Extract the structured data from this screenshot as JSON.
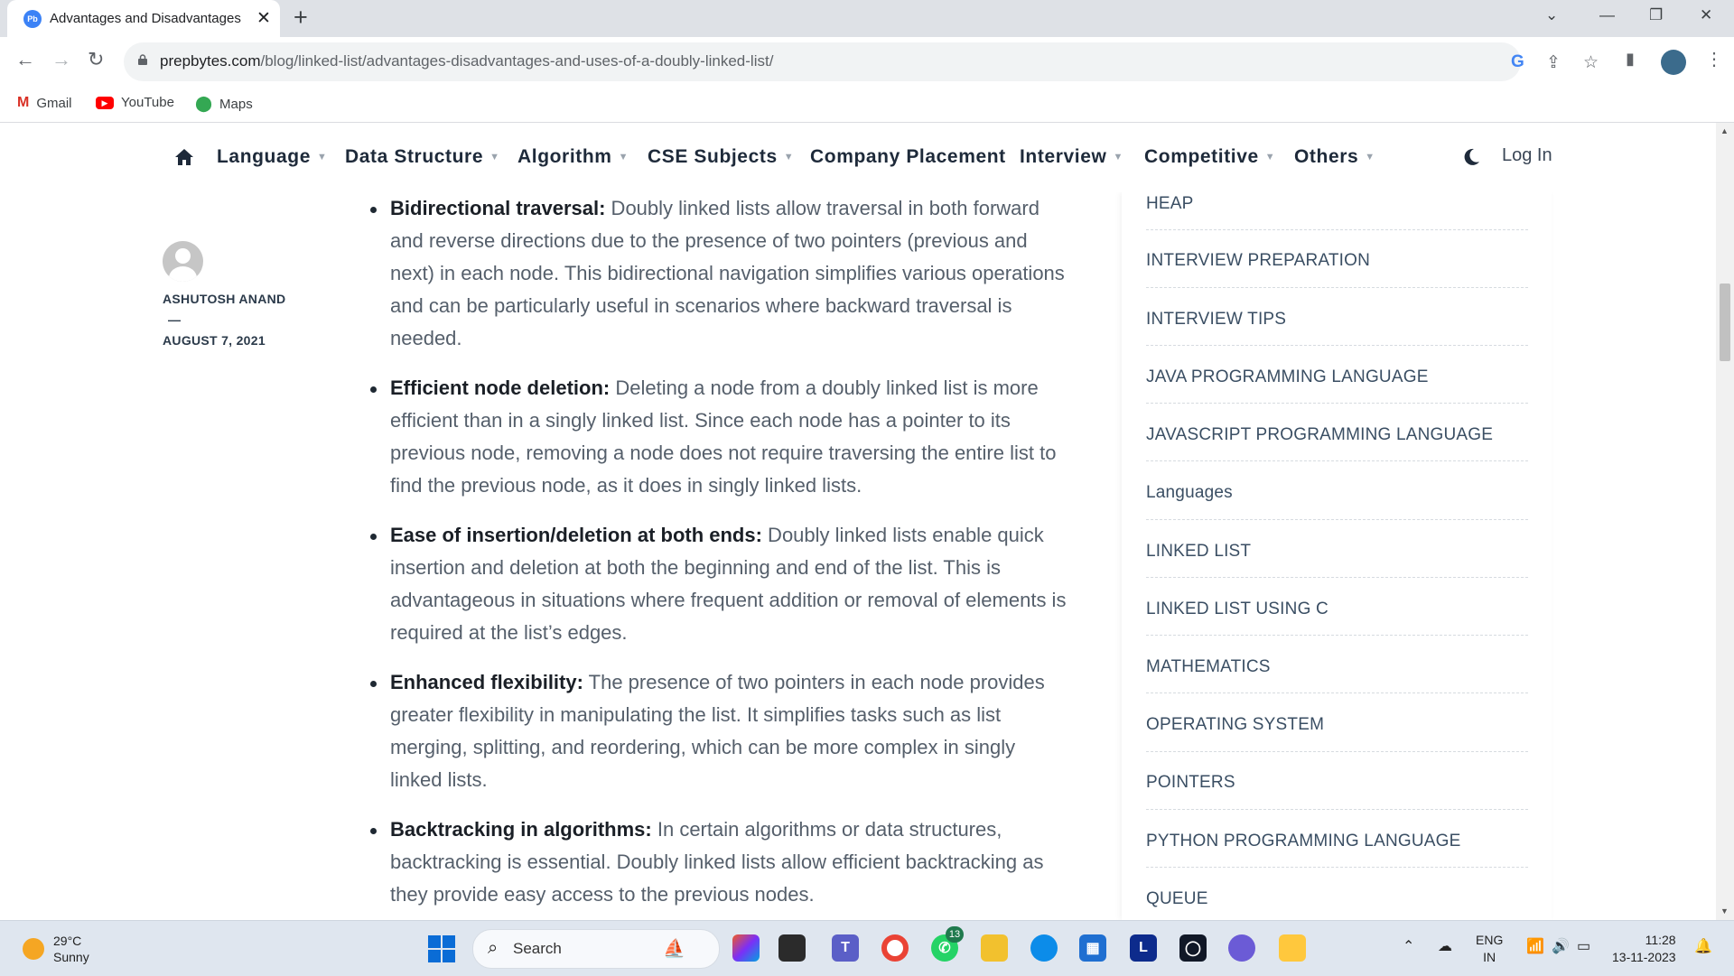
{
  "browser": {
    "tab_title": "Advantages and Disadvantages",
    "tab_favicon_text": "Pb",
    "url_host": "prepbytes.com",
    "url_path": "/blog/linked-list/advantages-disadvantages-and-uses-of-a-doubly-linked-list/",
    "bookmarks": [
      {
        "label": "Gmail",
        "icon": "gmail-icon"
      },
      {
        "label": "YouTube",
        "icon": "youtube-icon"
      },
      {
        "label": "Maps",
        "icon": "maps-icon"
      }
    ]
  },
  "site_nav": {
    "items": [
      {
        "label": "Language",
        "has_dropdown": true
      },
      {
        "label": "Data Structure",
        "has_dropdown": true
      },
      {
        "label": "Algorithm",
        "has_dropdown": true
      },
      {
        "label": "CSE Subjects",
        "has_dropdown": true
      },
      {
        "label": "Company Placement",
        "has_dropdown": false
      },
      {
        "label": "Interview",
        "has_dropdown": true
      },
      {
        "label": "Competitive",
        "has_dropdown": true
      },
      {
        "label": "Others",
        "has_dropdown": true
      }
    ],
    "login_label": "Log In"
  },
  "author": {
    "name": "ASHUTOSH ANAND",
    "separator": "—",
    "date": "AUGUST 7, 2021"
  },
  "article": {
    "bullets": [
      {
        "title": "Bidirectional traversal:",
        "text": " Doubly linked lists allow traversal in both forward and reverse directions due to the presence of two pointers (previous and next) in each node. This bidirectional navigation simplifies various operations and can be particularly useful in scenarios where backward traversal is needed."
      },
      {
        "title": "Efficient node deletion:",
        "text": " Deleting a node from a doubly linked list is more efficient than in a singly linked list. Since each node has a pointer to its previous node, removing a node does not require traversing the entire list to find the previous node, as it does in singly linked lists."
      },
      {
        "title": "Ease of insertion/deletion at both ends:",
        "text": " Doubly linked lists enable quick insertion and deletion at both the beginning and end of the list. This is advantageous in situations where frequent addition or removal of elements is required at the list’s edges."
      },
      {
        "title": "Enhanced flexibility:",
        "text": " The presence of two pointers in each node provides greater flexibility in manipulating the list. It simplifies tasks such as list merging, splitting, and reordering, which can be more complex in singly linked lists."
      },
      {
        "title": "Backtracking in algorithms:",
        "text": " In certain algorithms or data structures, backtracking is essential. Doubly linked lists allow efficient backtracking as they provide easy access to the previous nodes."
      }
    ]
  },
  "sidebar": {
    "categories": [
      "HEAP",
      "INTERVIEW PREPARATION",
      "INTERVIEW TIPS",
      "JAVA PROGRAMMING LANGUAGE",
      "JAVASCRIPT PROGRAMMING LANGUAGE",
      "Languages",
      "LINKED LIST",
      "LINKED LIST USING C",
      "MATHEMATICS",
      "OPERATING SYSTEM",
      "POINTERS",
      "PYTHON PROGRAMMING LANGUAGE",
      "QUEUE"
    ]
  },
  "taskbar": {
    "weather_temp": "29°C",
    "weather_desc": "Sunny",
    "search_placeholder": "Search",
    "whatsapp_badge": "13",
    "lang_line1": "ENG",
    "lang_line2": "IN",
    "time": "11:28",
    "date": "13-11-2023"
  },
  "colors": {
    "nav_text": "#1e2a3a",
    "body_text": "#555f6b",
    "sidebar_text": "#3a4e63",
    "taskbar_bg": "#dfe6ef"
  }
}
